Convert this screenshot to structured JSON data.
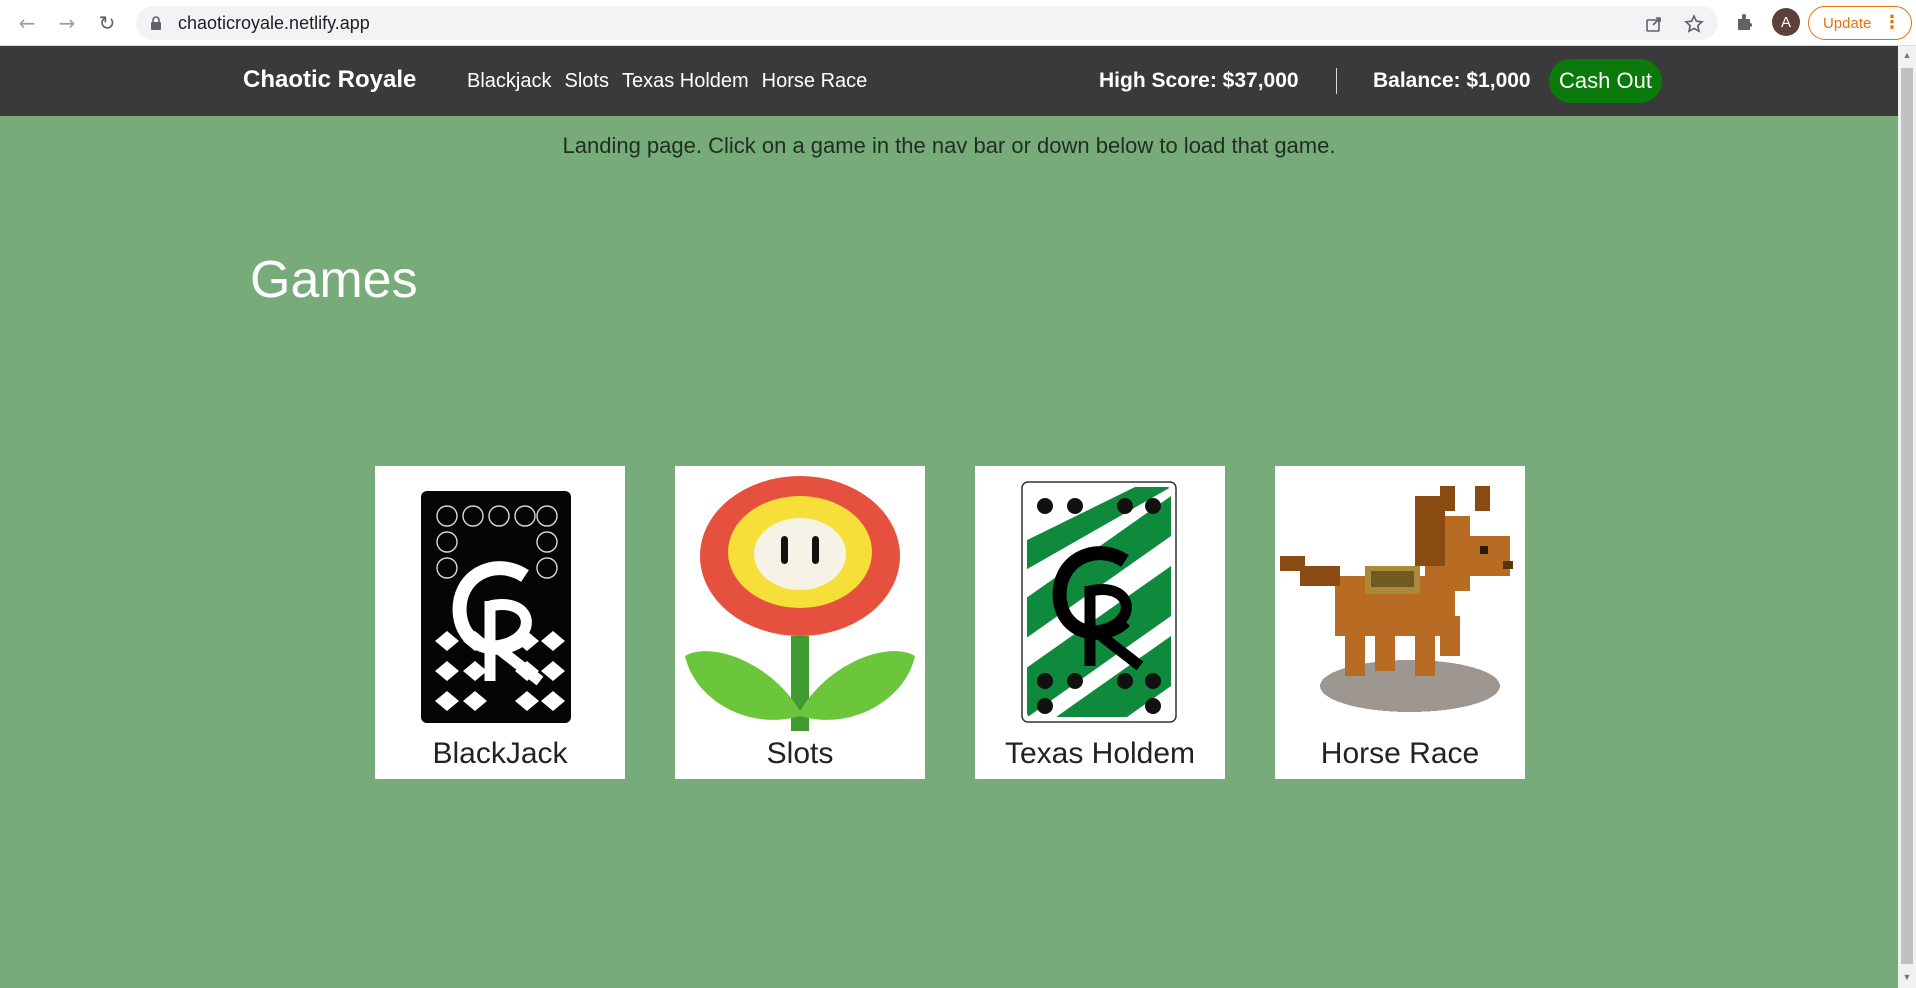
{
  "browser": {
    "url": "chaoticroyale.netlify.app",
    "profile_initial": "A",
    "update_label": "Update"
  },
  "nav": {
    "brand": "Chaotic Royale",
    "links": [
      "Blackjack",
      "Slots",
      "Texas Holdem",
      "Horse Race"
    ],
    "high_score": "High Score: $37,000",
    "balance": "Balance: $1,000",
    "cash_out": "Cash Out"
  },
  "main": {
    "landing_text": "Landing page. Click on a game in the nav bar or down below to load that game.",
    "heading": "Games",
    "games": [
      {
        "label": "BlackJack",
        "icon": "black-card-back-icon"
      },
      {
        "label": "Slots",
        "icon": "fire-flower-icon"
      },
      {
        "label": "Texas Holdem",
        "icon": "green-card-back-icon"
      },
      {
        "label": "Horse Race",
        "icon": "pixel-horse-icon"
      }
    ]
  },
  "colors": {
    "page_bg": "#77ab79",
    "nav_bg": "#3a3a3a",
    "cash_out_bg": "#0a7a0a",
    "update_accent": "#e8710a"
  }
}
